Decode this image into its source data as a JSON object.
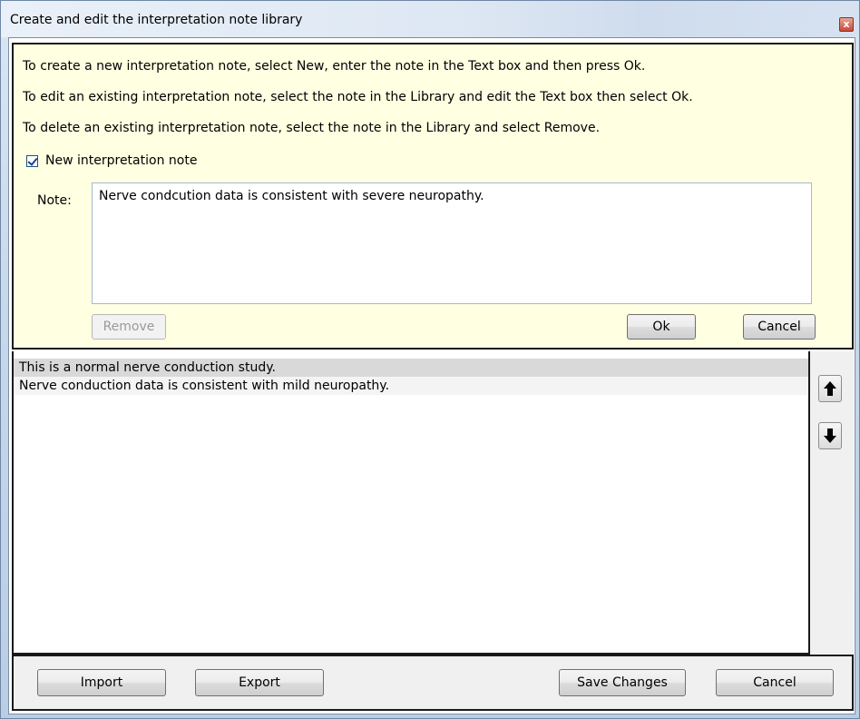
{
  "window": {
    "title": "Create and edit the interpretation note library",
    "close_glyph": "x"
  },
  "instructions": [
    "To create a new interpretation note, select New, enter the note in the Text box and then press Ok.",
    "To edit an existing interpretation note, select the note in the Library and edit the Text box then select Ok.",
    "To delete an existing interpretation note, select the note in the Library and select Remove."
  ],
  "new_note_checkbox": {
    "label": "New interpretation note",
    "checked": true
  },
  "note": {
    "label": "Note:",
    "value": "Nerve condcution data is consistent with severe neuropathy."
  },
  "edit_buttons": {
    "remove": "Remove",
    "ok": "Ok",
    "cancel": "Cancel"
  },
  "library": {
    "items": [
      "This is a normal nerve conduction study.",
      "Nerve conduction data is consistent with mild neuropathy."
    ],
    "selected_index": 0
  },
  "side_buttons": {
    "up_icon": "arrow-up-icon",
    "down_icon": "arrow-down-icon"
  },
  "footer": {
    "import": "Import",
    "export": "Export",
    "save_changes": "Save Changes",
    "cancel": "Cancel"
  },
  "colors": {
    "panel_background": "#ffffe2",
    "selected_row": "#d9d9d9",
    "title_bar": "#dde7f3"
  }
}
